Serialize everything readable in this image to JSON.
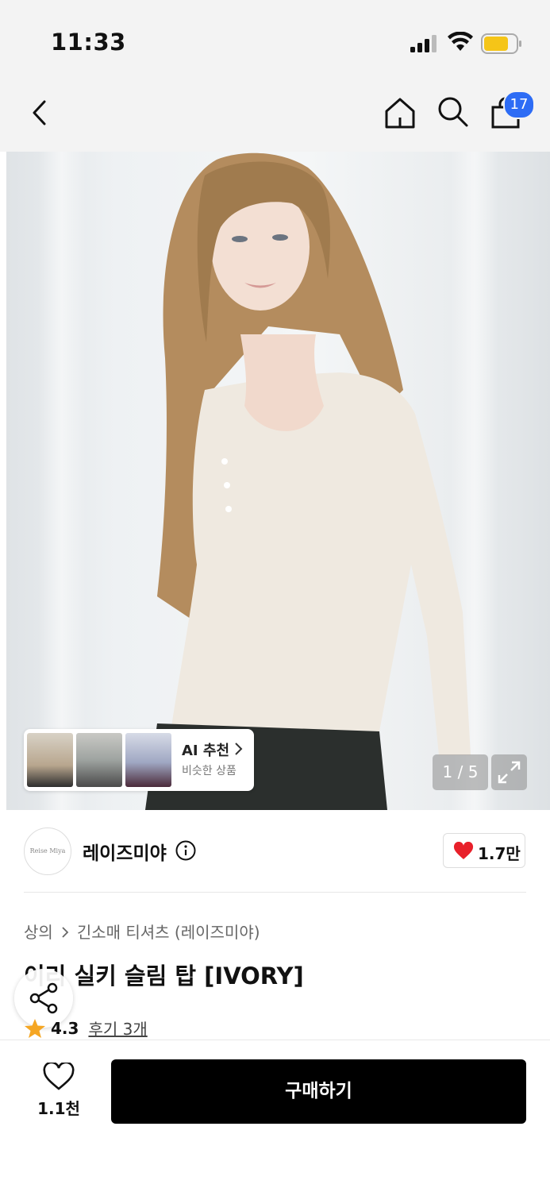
{
  "status_bar": {
    "time": "11:33",
    "battery_color": "#f5c518"
  },
  "nav": {
    "back_icon": "chevron-left-icon",
    "home_icon": "home-icon",
    "search_icon": "search-icon",
    "cart_icon": "shopping-bag-icon",
    "cart_count": "17",
    "badge_color": "#2d6cf5"
  },
  "gallery": {
    "page_indicator": "1 / 5",
    "expand_icon": "expand-icon",
    "ai_recommend": {
      "title": "AI 추천",
      "subtitle": "비슷한 상품"
    }
  },
  "brand": {
    "logo_text": "Reise Miya",
    "name": "레이즈미야",
    "info_icon": "info-icon",
    "like_count": "1.7만",
    "heart_color": "#e8202a"
  },
  "breadcrumb": {
    "category": "상의",
    "subcategory": "긴소매 티셔츠 (레이즈미야)"
  },
  "product": {
    "title": "이리 실키 슬림 탑 [IVORY]",
    "rating": "4.3",
    "reviews": "후기 3개",
    "star_color": "#f5a623"
  },
  "bottom_bar": {
    "wishlist_count": "1.1천",
    "buy_label": "구매하기"
  }
}
